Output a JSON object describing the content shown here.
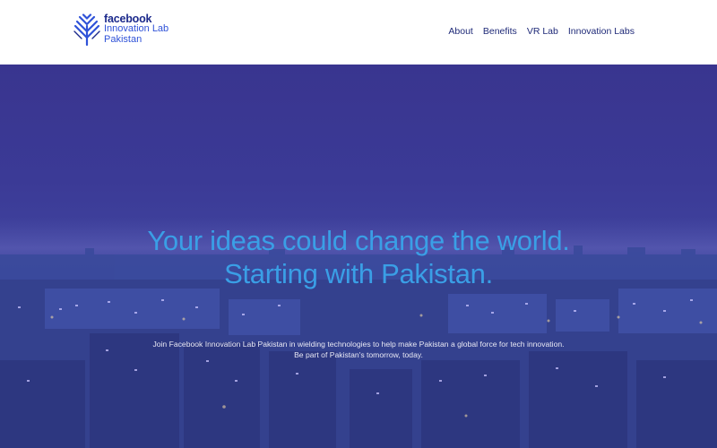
{
  "header": {
    "logo": {
      "brand": "facebook",
      "line1": "Innovation Lab",
      "line2": "Pakistan",
      "icon": "tree-logo-icon"
    },
    "nav": [
      {
        "label": "About"
      },
      {
        "label": "Benefits"
      },
      {
        "label": "VR Lab"
      },
      {
        "label": "Innovation Labs"
      }
    ]
  },
  "hero": {
    "title_line1": "Your ideas could change the world.",
    "title_line2": "Starting with Pakistan.",
    "subtitle_line1": "Join Facebook Innovation Lab Pakistan in wielding technologies to help make Pakistan a global force for tech innovation.",
    "subtitle_line2": "Be part of Pakistan's tomorrow, today.",
    "background": "night-city-skyline-image"
  },
  "colors": {
    "brand_dark": "#1c2a8c",
    "brand_blue": "#2f52d8",
    "title_blue": "#3a9fe6",
    "overlay": "#3b3a96"
  }
}
